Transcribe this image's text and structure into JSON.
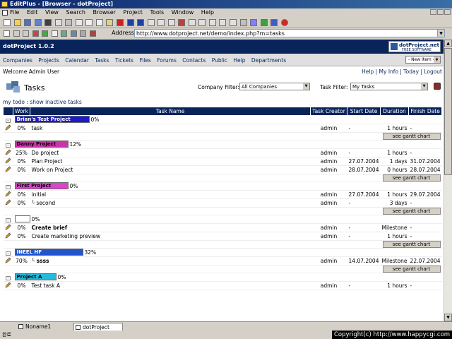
{
  "window": {
    "title": "EditPlus - [Browser - dotProject]"
  },
  "menu": [
    "File",
    "Edit",
    "View",
    "Search",
    "Browser",
    "Project",
    "Tools",
    "Window",
    "Help"
  ],
  "address": {
    "label": "Address",
    "url": "http://www.dotproject.net/demo/index.php?m=tasks"
  },
  "app": {
    "title": "dotProject 1.0.2",
    "logo_line1": "dotProject.net",
    "logo_line2": "FREE SOFTWARE",
    "new_item": "- New Item -"
  },
  "nav": [
    "Companies",
    "Projects",
    "Calendar",
    "Tasks",
    "Tickets",
    "Files",
    "Forums",
    "Contacts",
    "Public",
    "Help",
    "Departments"
  ],
  "welcome": "Welcome Admin User",
  "top_links": "Help | My Info | Today | Logout",
  "page": {
    "title": "Tasks",
    "company_filter_label": "Company Filter:",
    "company_filter_value": "All Companies",
    "task_filter_label": "Task Filter:",
    "task_filter_value": "My Tasks",
    "subnav": "my todo : show inactive tasks"
  },
  "table": {
    "headers": [
      "",
      "Work",
      "Task Name",
      "Task Creator",
      "Start Date",
      "Duration",
      "Finish Date"
    ],
    "gantt_label": "see gantt chart",
    "projects": [
      {
        "name": "Brian's Test Project",
        "color": "#1c1ccc",
        "text_color": "#ffffff",
        "pct": "0%",
        "bar_fraction": 0.12,
        "tasks": [
          {
            "work": "0%",
            "name": "task",
            "creator": "admin",
            "start": "-",
            "duration": "1 hours",
            "finish": "-"
          }
        ]
      },
      {
        "name": "Danny Project",
        "color": "#cc33aa",
        "text_color": "#000000",
        "pct": "12%",
        "bar_fraction": 0.12,
        "tasks": [
          {
            "work": "25%",
            "name": "Do project",
            "creator": "admin",
            "start": "-",
            "duration": "1 hours",
            "finish": "-"
          },
          {
            "work": "0%",
            "name": "Plan Project",
            "creator": "admin",
            "start": "27.07.2004",
            "duration": "1 days",
            "finish": "31.07.2004"
          },
          {
            "work": "0%",
            "name": "Work on Project",
            "creator": "admin",
            "start": "28.07.2004",
            "duration": "0 hours",
            "finish": "28.07.2004"
          }
        ]
      },
      {
        "name": "First Project",
        "color": "#dd44cc",
        "text_color": "#000000",
        "pct": "0%",
        "bar_fraction": 0.12,
        "tasks": [
          {
            "work": "0%",
            "name": "initial",
            "creator": "admin",
            "start": "27.07.2004",
            "duration": "1 hours",
            "finish": "29.07.2004"
          },
          {
            "work": "0%",
            "name": "second",
            "creator": "admin",
            "start": "-",
            "duration": "3 days",
            "finish": "-",
            "child": true
          }
        ]
      },
      {
        "name": "",
        "color": "#ffffff",
        "text_color": "#000000",
        "pct": "0%",
        "bar_fraction": 0.12,
        "tasks": [
          {
            "work": "0%",
            "name": "Create brief",
            "creator": "admin",
            "start": "-",
            "duration": "Milestone",
            "finish": "-",
            "bold": true
          },
          {
            "work": "0%",
            "name": "Create marketing preview",
            "creator": "admin",
            "start": "-",
            "duration": "1 hours",
            "finish": "-"
          }
        ]
      },
      {
        "name": "INEEL HF",
        "color": "#2255cc",
        "text_color": "#ffffff",
        "pct": "32%",
        "bar_fraction": 0.35,
        "tasks": [
          {
            "work": "70%",
            "name": "ssss",
            "creator": "admin",
            "start": "14.07.2004",
            "duration": "Milestone",
            "finish": "22.07.2004",
            "bold": true,
            "child": true
          }
        ]
      },
      {
        "name": "Project A",
        "color": "#22bbdd",
        "text_color": "#000000",
        "pct": "0%",
        "bar_fraction": 0.12,
        "tasks": [
          {
            "work": "0%",
            "name": "Test task A",
            "creator": "admin",
            "start": "-",
            "duration": "1 hours",
            "finish": "-"
          }
        ]
      }
    ]
  },
  "tabs": [
    "Noname1",
    "dotProject"
  ],
  "status_left": "완료",
  "copyright": "Copyright(c) http://www.happycgi.com"
}
